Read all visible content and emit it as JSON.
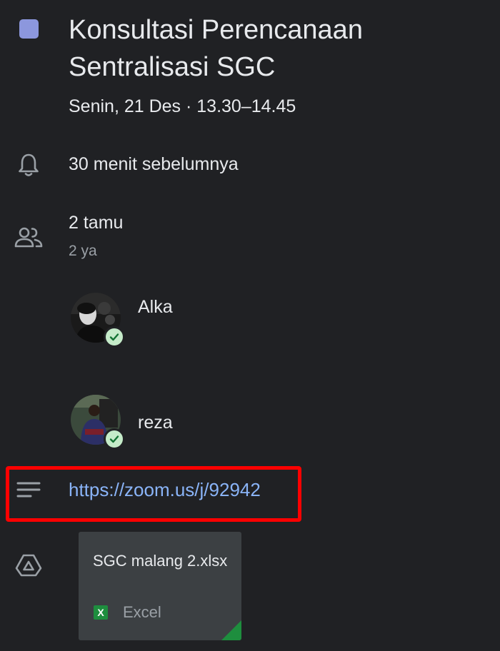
{
  "event": {
    "color": "#8c97dd",
    "title": "Konsultasi Perencanaan Sentralisasi SGC",
    "datetime": "Senin, 21 Des · 13.30–14.45"
  },
  "reminder": {
    "icon": "bell-icon",
    "text": "30 menit sebelumnya"
  },
  "guests": {
    "icon": "people-icon",
    "count_text": "2 tamu",
    "rsvp_summary": "2 ya",
    "list": [
      {
        "name": "Alka",
        "status_icon": "check-icon"
      },
      {
        "name": "reza",
        "status_icon": "check-icon"
      }
    ]
  },
  "description": {
    "icon": "notes-icon",
    "link": "https://zoom.us/j/92942"
  },
  "attachments": {
    "icon": "drive-icon",
    "items": [
      {
        "name": "SGC malang 2.xlsx",
        "type": "Excel",
        "type_icon_letter": "X",
        "accent": "#1e8e3e"
      }
    ]
  }
}
